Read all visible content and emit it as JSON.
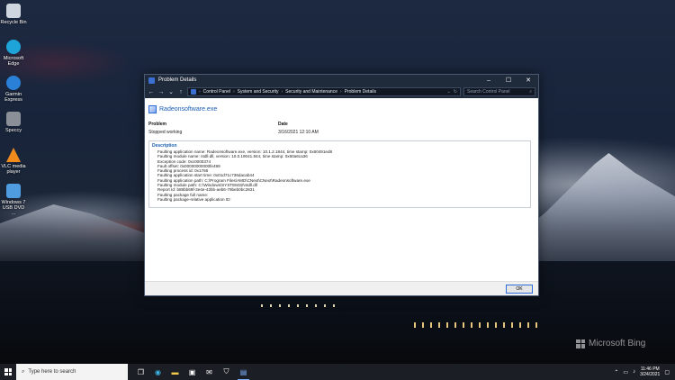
{
  "desktop": {
    "icons": [
      {
        "label": "Recycle Bin",
        "icon": "recycle-bin-icon",
        "color": "#cfd6df"
      },
      {
        "label": "Microsoft Edge",
        "icon": "edge-icon",
        "color": "#1fa4d9"
      },
      {
        "label": "Garmin Express",
        "icon": "garmin-icon",
        "color": "#2a7fd6"
      },
      {
        "label": "Speccy",
        "icon": "speccy-icon",
        "color": "#8a8f98"
      },
      {
        "label": "VLC media player",
        "icon": "vlc-icon",
        "color": "#f08a1c"
      },
      {
        "label": "Windows 7 USB DVD ...",
        "icon": "usb-dvd-tool-icon",
        "color": "#4f9de0"
      }
    ],
    "watermark": "Microsoft Bing"
  },
  "window": {
    "title": "Problem Details",
    "controls": {
      "minimize": "–",
      "maximize": "☐",
      "close": "✕"
    },
    "breadcrumb": [
      "Control Panel",
      "System and Security",
      "Security and Maintenance",
      "Problem Details"
    ],
    "search_placeholder": "Search Control Panel",
    "app_name": "Radeonsoftware.exe",
    "problem_header": "Problem",
    "problem_value": "Stopped working",
    "date_header": "Date",
    "date_value": "3/16/2021 12:10 AM",
    "description_title": "Description",
    "description_lines": [
      "Faulting application name: Radeonsoftware.exe, version: 10.1.2.1844, time stamp: 0x60491ed8",
      "Faulting module name: ntdll.dll, version: 10.0.19041.844, time stamp: 0x60a6ca36",
      "Exception code: 0xc0000374",
      "Fault offset: 0x00000000000fe499",
      "Faulting process id: 0x1766",
      "Faulting application start time: 0x01d71c736dacab44",
      "Faulting application path: C:\\Program Files\\AMD\\CNext\\CNext\\Radeonsoftware.exe",
      "Faulting module path: C:\\Windows\\SYSTEM32\\ntdll.dll",
      "Report Id: b88bb69f-3e4e-42bb-aeb6-79beb0bc2831",
      "Faulting package full name:",
      "Faulting package-relative application ID:"
    ],
    "ok_label": "OK"
  },
  "taskbar": {
    "search_placeholder": "Type here to search",
    "items": [
      {
        "icon": "task-view-icon",
        "glyph": "❐"
      },
      {
        "icon": "edge-taskbar-icon",
        "glyph": "◉"
      },
      {
        "icon": "file-explorer-icon",
        "glyph": "▬"
      },
      {
        "icon": "store-icon",
        "glyph": "▣"
      },
      {
        "icon": "mail-icon",
        "glyph": "✉"
      },
      {
        "icon": "security-icon",
        "glyph": "⛉"
      },
      {
        "icon": "control-panel-icon",
        "glyph": "▤"
      }
    ],
    "time": "11:46 PM",
    "date": "3/24/2021"
  },
  "colors": {
    "accent": "#1a5fb4",
    "titlebar": "#1f2a3a",
    "taskbar": "#1b1e24"
  }
}
